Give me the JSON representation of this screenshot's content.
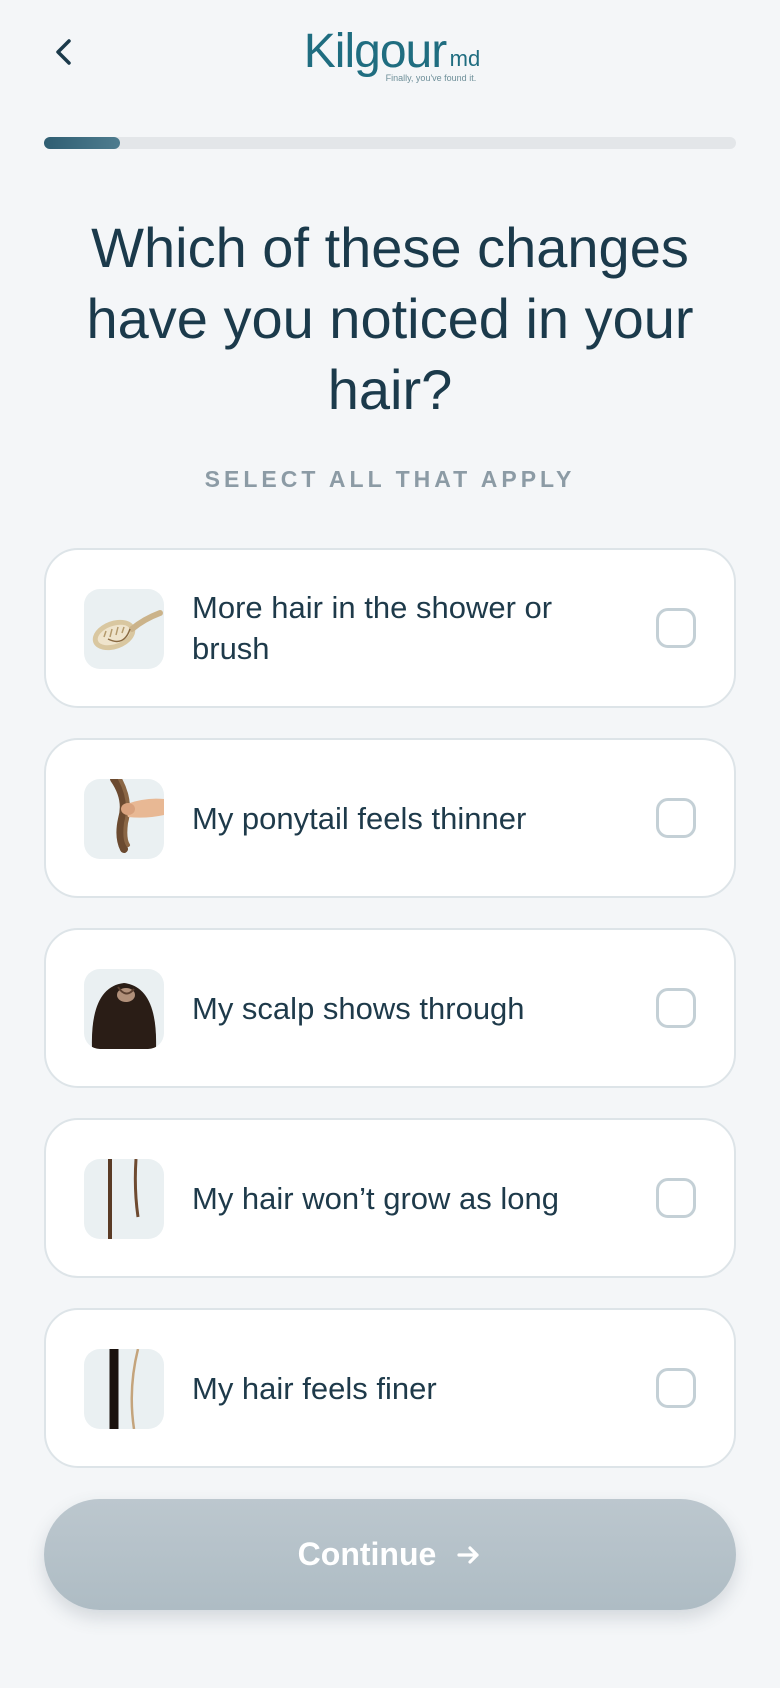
{
  "header": {
    "back_icon": "chevron-left-icon",
    "logo_text": "Kilgour",
    "logo_suffix": "md",
    "logo_tagline": "Finally, you've found it."
  },
  "progress": {
    "fraction": 0.11
  },
  "question": {
    "title": "Which of these changes have you noticed in your hair?",
    "hint": "SELECT ALL THAT APPLY"
  },
  "options": [
    {
      "label": "More hair in the shower or brush",
      "image": "hairbrush-image",
      "checked": false
    },
    {
      "label": "My ponytail feels thinner",
      "image": "ponytail-image",
      "checked": false
    },
    {
      "label": "My scalp shows through",
      "image": "scalp-image",
      "checked": false
    },
    {
      "label": "My hair won’t grow as long",
      "image": "hair-strands-image",
      "checked": false
    },
    {
      "label": "My hair feels finer",
      "image": "fine-hair-image",
      "checked": false
    }
  ],
  "footer": {
    "continue_label": "Continue",
    "continue_icon": "arrow-right-icon"
  },
  "colors": {
    "background": "#f4f6f8",
    "brand": "#1f6d80",
    "text": "#1b3a4b",
    "button_disabled": "#b3c0c8"
  }
}
